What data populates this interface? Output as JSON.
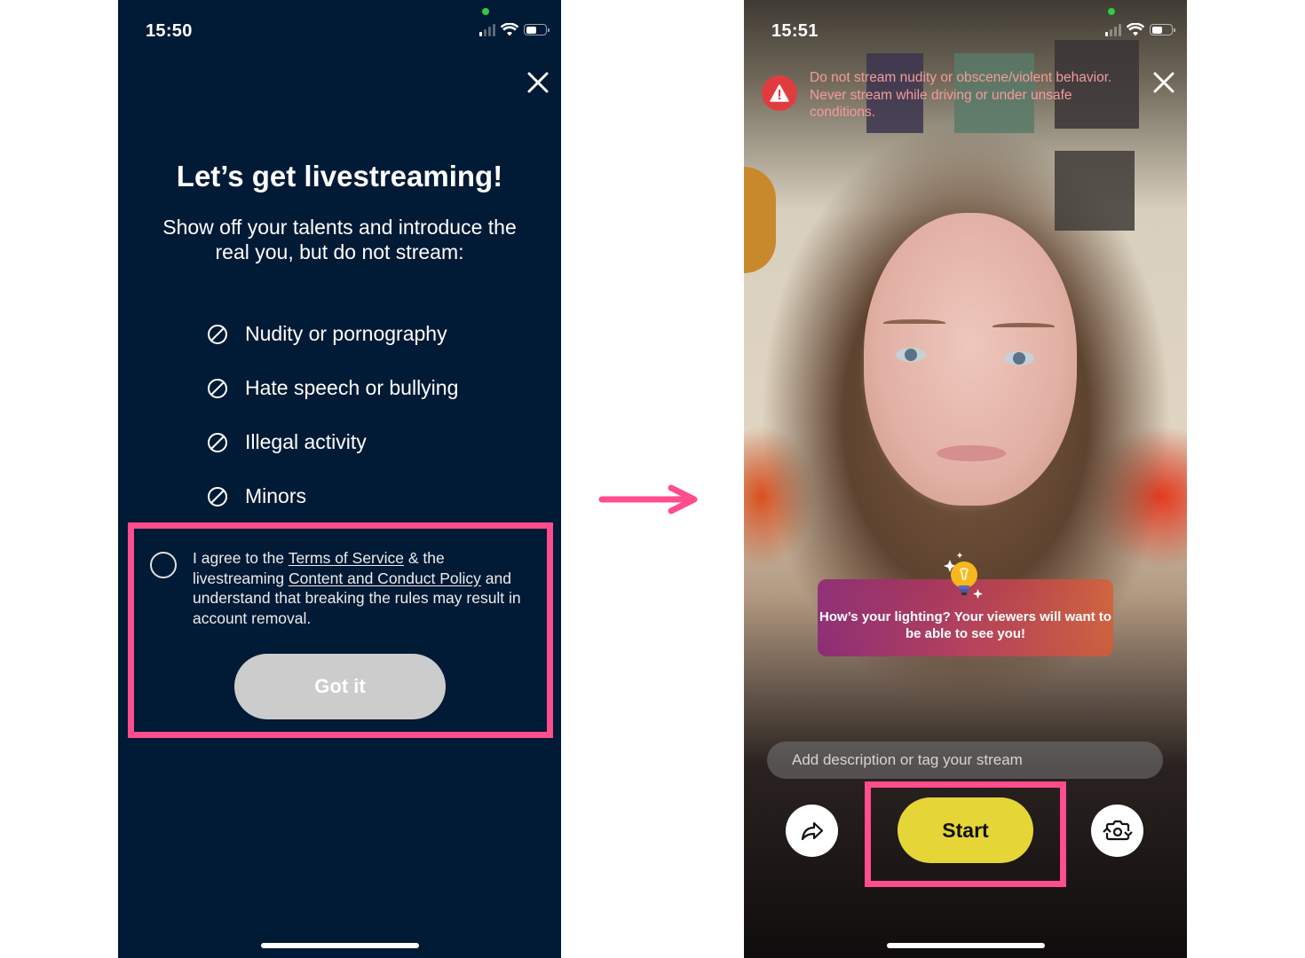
{
  "left_screen": {
    "status_bar": {
      "time": "15:50",
      "battery_level": 0.5,
      "signal_bars": 1
    },
    "close_icon": "close-icon",
    "title": "Let’s get livestreaming!",
    "subtitle": "Show off your talents and introduce the real you, but do not stream:",
    "rules": [
      {
        "icon": "prohibited-icon",
        "label": "Nudity or pornography"
      },
      {
        "icon": "prohibited-icon",
        "label": "Hate speech or bullying"
      },
      {
        "icon": "prohibited-icon",
        "label": "Illegal activity"
      },
      {
        "icon": "prohibited-icon",
        "label": "Minors"
      }
    ],
    "agreement": {
      "checked": false,
      "prefix": "I agree to the ",
      "terms_link": "Terms of Service",
      "middle": " & the livestreaming ",
      "policy_link": "Content and Conduct Policy",
      "suffix": " and understand that breaking the rules may result in account removal."
    },
    "got_it_label": "Got it"
  },
  "arrow": {
    "icon": "right-arrow-icon",
    "color": "#ff4d8d"
  },
  "right_screen": {
    "status_bar": {
      "time": "15:51",
      "battery_level": 0.5,
      "signal_bars": 1
    },
    "warning": {
      "icon": "warning-icon",
      "text": "Do not stream nudity or obscene/violent behavior. Never stream while driving or under unsafe conditions."
    },
    "tip": {
      "icon": "lightbulb-icon",
      "text": "How’s your lighting? Your viewers will want to be able to see you!"
    },
    "description_placeholder": "Add description or tag your stream",
    "description_value": "",
    "share_icon": "share-icon",
    "start_label": "Start",
    "flip_camera_icon": "flip-camera-icon"
  },
  "colors": {
    "left_background": "#011a35",
    "highlight": "#ff4d8d",
    "got_it_disabled": "#cccccc",
    "start_button": "#e6d537",
    "warning_red": "#e03c3f",
    "warning_text": "#f49b9b"
  }
}
